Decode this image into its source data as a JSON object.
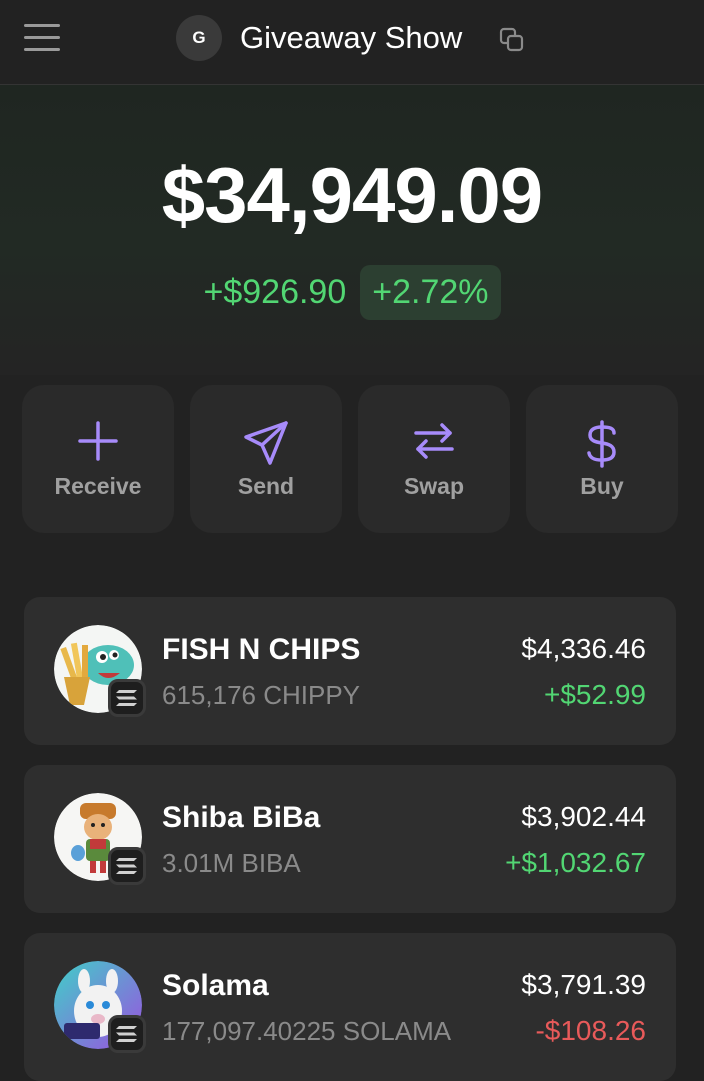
{
  "header": {
    "avatar_initial": "G",
    "account_name": "Giveaway Show"
  },
  "portfolio": {
    "balance": "$34,949.09",
    "change_amount": "+$926.90",
    "change_percent": "+2.72%"
  },
  "actions": [
    {
      "label": "Receive",
      "icon": "plus-icon"
    },
    {
      "label": "Send",
      "icon": "send-icon"
    },
    {
      "label": "Swap",
      "icon": "swap-icon"
    },
    {
      "label": "Buy",
      "icon": "dollar-icon"
    }
  ],
  "tokens": [
    {
      "name": "FISH N CHIPS",
      "amount": "615,176 CHIPPY",
      "value": "$4,336.46",
      "change": "+$52.99",
      "direction": "up"
    },
    {
      "name": "Shiba BiBa",
      "amount": "3.01M BIBA",
      "value": "$3,902.44",
      "change": "+$1,032.67",
      "direction": "up"
    },
    {
      "name": "Solama",
      "amount": "177,097.40225 SOLAMA",
      "value": "$3,791.39",
      "change": "-$108.26",
      "direction": "down"
    }
  ],
  "colors": {
    "accent": "#a78bfa",
    "positive": "#52d673",
    "negative": "#e85a5a",
    "background": "#222222",
    "card": "#2e2e2e"
  }
}
